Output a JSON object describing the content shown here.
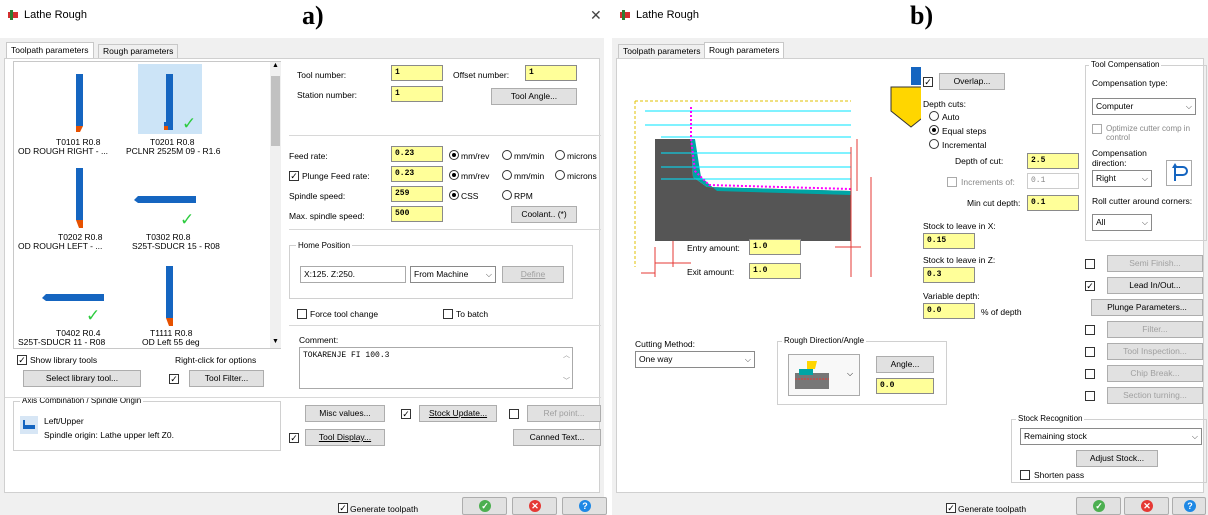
{
  "left": {
    "label": "a)",
    "title": "Lathe Rough",
    "tabs": [
      "Toolpath parameters",
      "Rough parameters"
    ],
    "tools": [
      {
        "name": "T0101 R0.8",
        "desc": "OD ROUGH RIGHT - ..."
      },
      {
        "name": "T0201 R0.8",
        "desc": "PCLNR 2525M 09 - R1.6"
      },
      {
        "name": "T0202 R0.8",
        "desc": "OD ROUGH LEFT - ..."
      },
      {
        "name": "T0302 R0.8",
        "desc": "S25T-SDUCR 15 - R08"
      },
      {
        "name": "T0402 R0.4",
        "desc": "S25T-SDUCR 11 - R08"
      },
      {
        "name": "T1111 R0.8",
        "desc": "OD Left 55 deg"
      }
    ],
    "show_library": "Show library tools",
    "right_click": "Right-click for options",
    "select_library": "Select library tool...",
    "tool_filter": "Tool Filter...",
    "axis_group": "Axis Combination / Spindle Origin",
    "axis_combo": "Left/Upper",
    "spindle_origin": "Spindle origin: Lathe upper left  Z0.",
    "tool_number_lbl": "Tool number:",
    "tool_number": "1",
    "offset_number_lbl": "Offset number:",
    "offset_number": "1",
    "station_number_lbl": "Station number:",
    "station_number": "1",
    "tool_angle": "Tool Angle...",
    "feed_rate_lbl": "Feed rate:",
    "feed_rate": "0.23",
    "plunge_lbl": "Plunge Feed rate:",
    "plunge": "0.23",
    "spindle_lbl": "Spindle speed:",
    "spindle": "259",
    "max_spindle_lbl": "Max. spindle speed:",
    "max_spindle": "500",
    "mmrev": "mm/rev",
    "mmmin": "mm/min",
    "microns": "microns",
    "css": "CSS",
    "rpm": "RPM",
    "coolant": "Coolant.. (*)",
    "home_group": "Home Position",
    "home_value": "X:125.  Z:250.",
    "from_machine": "From Machine",
    "define": "Define",
    "force_tool": "Force tool change",
    "to_batch": "To batch",
    "comment_lbl": "Comment:",
    "comment": "TOKARENJE FI 100.3",
    "misc_values": "Misc values...",
    "stock_update": "Stock Update...",
    "ref_point": "Ref point...",
    "tool_display": "Tool Display...",
    "canned_text": "Canned Text...",
    "generate": "Generate toolpath"
  },
  "right": {
    "label": "b)",
    "title": "Lathe Rough",
    "tabs": [
      "Toolpath parameters",
      "Rough parameters"
    ],
    "overlap": "Overlap...",
    "depth_cuts": "Depth cuts:",
    "auto": "Auto",
    "equal_steps": "Equal steps",
    "incremental": "Incremental",
    "depth_of_cut_lbl": "Depth of cut:",
    "depth_of_cut": "2.5",
    "increments_lbl": "Increments of:",
    "increments": "0.1",
    "min_cut_lbl": "Min cut depth:",
    "min_cut": "0.1",
    "stock_x_lbl": "Stock to leave in X:",
    "stock_x": "0.15",
    "stock_z_lbl": "Stock to leave in Z:",
    "stock_z": "0.3",
    "variable_lbl": "Variable depth:",
    "variable": "0.0",
    "pct_depth": "% of depth",
    "entry_lbl": "Entry amount:",
    "entry": "1.0",
    "exit_lbl": "Exit amount:",
    "exit": "1.0",
    "tool_comp_group": "Tool Compensation",
    "comp_type_lbl": "Compensation type:",
    "comp_type": "Computer",
    "optimize": "Optimize cutter comp in control",
    "comp_dir_lbl": "Compensation direction:",
    "comp_dir": "Right",
    "roll_lbl": "Roll cutter around corners:",
    "roll": "All",
    "semi_finish": "Semi Finish...",
    "lead_inout": "Lead In/Out...",
    "plunge_params": "Plunge Parameters...",
    "filter": "Filter...",
    "tool_inspection": "Tool Inspection...",
    "chip_break": "Chip Break...",
    "section_turning": "Section turning...",
    "cutting_method_lbl": "Cutting Method:",
    "cutting_method": "One way",
    "rough_dir_group": "Rough Direction/Angle",
    "angle_btn": "Angle...",
    "angle": "0.0",
    "stock_recog_group": "Stock Recognition",
    "stock_recog": "Remaining stock",
    "adjust_stock": "Adjust Stock...",
    "shorten": "Shorten pass",
    "generate": "Generate toolpath"
  },
  "colors": {
    "yellow_field": "#ffff99",
    "ok": "#4caf50",
    "cancel": "#e53935",
    "help": "#1e88e5",
    "check": "#2ecc40",
    "tool_blue": "#1565c0",
    "part_teal": "#00a5a5",
    "part_dark": "#555555"
  }
}
